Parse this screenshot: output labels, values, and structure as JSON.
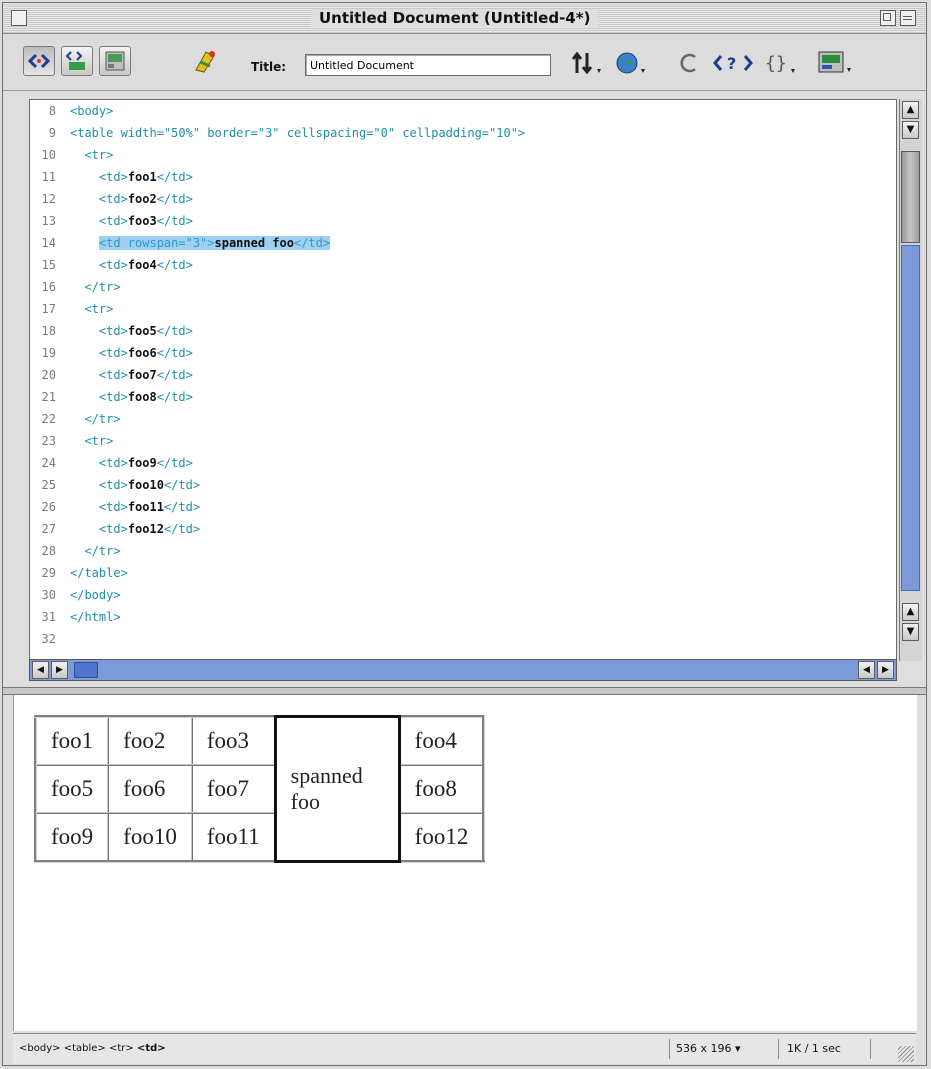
{
  "window": {
    "title": "Untitled Document (Untitled-4*)"
  },
  "toolbar": {
    "title_label": "Title:",
    "title_value": "Untitled Document",
    "icons": [
      "code-view-icon",
      "split-view-icon",
      "design-view-icon",
      "live-data-icon",
      "file-management-icon",
      "preview-browser-icon",
      "refresh-icon",
      "reference-icon",
      "code-navigation-icon",
      "view-options-icon"
    ]
  },
  "code": {
    "highlight_line": 14,
    "lines": [
      {
        "n": "8",
        "parts": [
          {
            "t": "tag",
            "v": "<body>"
          }
        ]
      },
      {
        "n": "9",
        "parts": [
          {
            "t": "tag",
            "v": "<table width=\"50%\" border=\"3\" cellspacing=\"0\" cellpadding=\"10\">"
          }
        ]
      },
      {
        "n": "10",
        "parts": [
          {
            "t": "tag",
            "v": "  <tr>"
          }
        ]
      },
      {
        "n": "11",
        "parts": [
          {
            "t": "tag",
            "v": "    <td>"
          },
          {
            "t": "txt",
            "v": "foo1"
          },
          {
            "t": "tag",
            "v": "</td>"
          }
        ]
      },
      {
        "n": "12",
        "parts": [
          {
            "t": "tag",
            "v": "    <td>"
          },
          {
            "t": "txt",
            "v": "foo2"
          },
          {
            "t": "tag",
            "v": "</td>"
          }
        ]
      },
      {
        "n": "13",
        "parts": [
          {
            "t": "tag",
            "v": "    <td>"
          },
          {
            "t": "txt",
            "v": "foo3"
          },
          {
            "t": "tag",
            "v": "</td>"
          }
        ]
      },
      {
        "n": "14",
        "parts": [
          {
            "t": "tag",
            "v": "    <td rowspan=\"3\">"
          },
          {
            "t": "txt",
            "v": "spanned foo"
          },
          {
            "t": "tag",
            "v": "</td>"
          }
        ]
      },
      {
        "n": "15",
        "parts": [
          {
            "t": "tag",
            "v": "    <td>"
          },
          {
            "t": "txt",
            "v": "foo4"
          },
          {
            "t": "tag",
            "v": "</td>"
          }
        ]
      },
      {
        "n": "16",
        "parts": [
          {
            "t": "tag",
            "v": "  </tr>"
          }
        ]
      },
      {
        "n": "17",
        "parts": [
          {
            "t": "tag",
            "v": "  <tr>"
          }
        ]
      },
      {
        "n": "18",
        "parts": [
          {
            "t": "tag",
            "v": "    <td>"
          },
          {
            "t": "txt",
            "v": "foo5"
          },
          {
            "t": "tag",
            "v": "</td>"
          }
        ]
      },
      {
        "n": "19",
        "parts": [
          {
            "t": "tag",
            "v": "    <td>"
          },
          {
            "t": "txt",
            "v": "foo6"
          },
          {
            "t": "tag",
            "v": "</td>"
          }
        ]
      },
      {
        "n": "20",
        "parts": [
          {
            "t": "tag",
            "v": "    <td>"
          },
          {
            "t": "txt",
            "v": "foo7"
          },
          {
            "t": "tag",
            "v": "</td>"
          }
        ]
      },
      {
        "n": "21",
        "parts": [
          {
            "t": "tag",
            "v": "    <td>"
          },
          {
            "t": "txt",
            "v": "foo8"
          },
          {
            "t": "tag",
            "v": "</td>"
          }
        ]
      },
      {
        "n": "22",
        "parts": [
          {
            "t": "tag",
            "v": "  </tr>"
          }
        ]
      },
      {
        "n": "23",
        "parts": [
          {
            "t": "tag",
            "v": "  <tr>"
          }
        ]
      },
      {
        "n": "24",
        "parts": [
          {
            "t": "tag",
            "v": "    <td>"
          },
          {
            "t": "txt",
            "v": "foo9"
          },
          {
            "t": "tag",
            "v": "</td>"
          }
        ]
      },
      {
        "n": "25",
        "parts": [
          {
            "t": "tag",
            "v": "    <td>"
          },
          {
            "t": "txt",
            "v": "foo10"
          },
          {
            "t": "tag",
            "v": "</td>"
          }
        ]
      },
      {
        "n": "26",
        "parts": [
          {
            "t": "tag",
            "v": "    <td>"
          },
          {
            "t": "txt",
            "v": "foo11"
          },
          {
            "t": "tag",
            "v": "</td>"
          }
        ]
      },
      {
        "n": "27",
        "parts": [
          {
            "t": "tag",
            "v": "    <td>"
          },
          {
            "t": "txt",
            "v": "foo12"
          },
          {
            "t": "tag",
            "v": "</td>"
          }
        ]
      },
      {
        "n": "28",
        "parts": [
          {
            "t": "tag",
            "v": "  </tr>"
          }
        ]
      },
      {
        "n": "29",
        "parts": [
          {
            "t": "tag",
            "v": "</table>"
          }
        ]
      },
      {
        "n": "30",
        "parts": [
          {
            "t": "tag",
            "v": "</body>"
          }
        ]
      },
      {
        "n": "31",
        "parts": [
          {
            "t": "tag",
            "v": "</html>"
          }
        ]
      },
      {
        "n": "32",
        "parts": []
      }
    ]
  },
  "design": {
    "cells": {
      "foo1": "foo1",
      "foo2": "foo2",
      "foo3": "foo3",
      "spanned": "spanned foo",
      "foo4": "foo4",
      "foo5": "foo5",
      "foo6": "foo6",
      "foo7": "foo7",
      "foo8": "foo8",
      "foo9": "foo9",
      "foo10": "foo10",
      "foo11": "foo11",
      "foo12": "foo12"
    }
  },
  "status": {
    "tags": [
      "<body>",
      "<table>",
      "<tr>",
      "<td>"
    ],
    "window_size": "536 x 196",
    "download": "1K / 1 sec"
  },
  "colors": {
    "tag": "#1f8fa8",
    "highlight": "#9fcff2",
    "scroll_blue": "#7c9ad7"
  }
}
